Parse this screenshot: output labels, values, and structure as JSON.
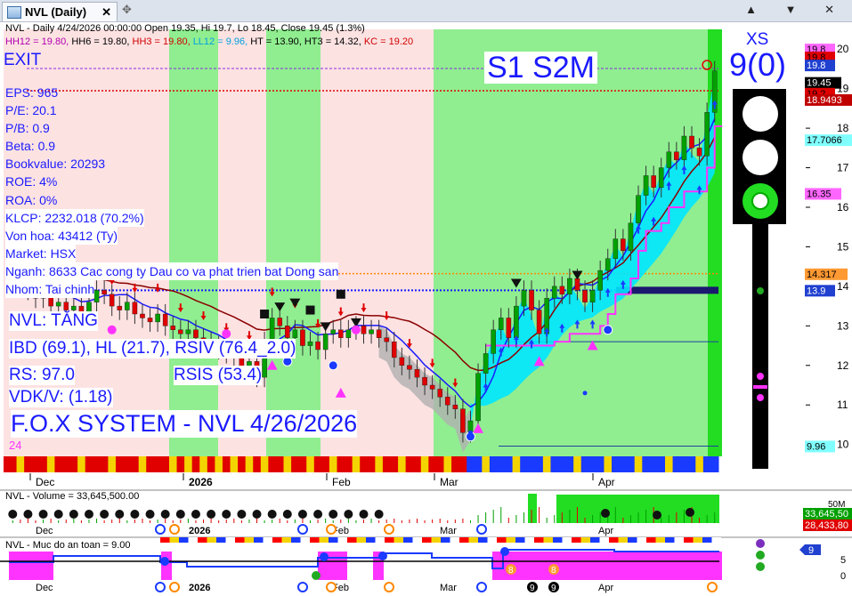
{
  "tab": {
    "title": "NVL (Daily)",
    "close": "✕",
    "pin": "✥",
    "win": [
      "▲",
      "▼",
      "✕"
    ]
  },
  "header": {
    "line1": "NVL - Daily 4/24/2026 00:00:00 Open 19.35, Hi 19.7, Lo 18.45, Close 19.45 (1.3%)",
    "line2": [
      {
        "text": "HH12 = 19.80, ",
        "color": "#b000b0"
      },
      {
        "text": "HH6 = 19.80, ",
        "color": "#000000"
      },
      {
        "text": "HH3 = 19.80, ",
        "color": "#d00000"
      },
      {
        "text": "LL12 = 9.96, ",
        "color": "#00a0e0"
      },
      {
        "text": "HT  = 13.90, ",
        "color": "#000000"
      },
      {
        "text": "HT3  = 14.32, ",
        "color": "#000000"
      },
      {
        "text": "KC = 19.20",
        "color": "#d00000"
      }
    ]
  },
  "overlay": {
    "exit": "EXIT",
    "fundamentals": [
      "EPS: 965",
      "P/E: 20.1",
      "P/B: 0.9",
      "Beta: 0.9",
      "Bookvalue: 20293",
      "ROE: 4%",
      "ROA: 0%",
      "KLCP: 2232.018 (70.2%)",
      "Von hoa: 43412 (Ty)",
      "Market: HSX",
      "Nganh: 8633 Cac cong ty Dau co va phat trien bat Dong san",
      "Nhom: Tai chinh"
    ],
    "status": "NVL: TĂNG",
    "ibd": "IBD (69.1), HL (21.7), RSIV (76.4_2.0)",
    "rs": "RS: 97.0",
    "rsis": "RSIS (53.4)",
    "vdk": "VDK/V:  (1.18)",
    "system": "F.O.X SYSTEM - NVL 4/26/2026",
    "counter": "24",
    "signal": "S1  S2M",
    "xs_label": "XS",
    "xs_value": "9(0)"
  },
  "price_axis": {
    "ticks": [
      "20",
      "19",
      "18",
      "17",
      "16",
      "15",
      "14",
      "13",
      "12",
      "11",
      "10"
    ],
    "badges": [
      {
        "text": "19.8",
        "bg": "#ff66ff",
        "fg": "#000000",
        "y": 19.8,
        "dy": -9
      },
      {
        "text": "19.8",
        "bg": "#e00000",
        "fg": "#000000",
        "y": 19.8,
        "dy": 0
      },
      {
        "text": "19.8",
        "bg": "#2040d0",
        "fg": "#ffffff",
        "y": 19.8,
        "dy": 9
      },
      {
        "text": "19.45",
        "bg": "#000000",
        "fg": "#ffffff",
        "y": 19.45,
        "dy": 13
      },
      {
        "text": "19.2",
        "bg": "#e00000",
        "fg": "#000000",
        "y": 19.2,
        "dy": 14
      },
      {
        "text": "18.9493",
        "bg": "#c00000",
        "fg": "#ffffff",
        "y": 18.9493,
        "dy": 10
      },
      {
        "text": "17.7066",
        "bg": "#80ffff",
        "fg": "#000000",
        "y": 17.7066,
        "dy": 0
      },
      {
        "text": "16.35",
        "bg": "#ff66ff",
        "fg": "#000000",
        "y": 16.35,
        "dy": 0
      },
      {
        "text": "14.317",
        "bg": "#ff9933",
        "fg": "#000000",
        "y": 14.317,
        "dy": 0
      },
      {
        "text": "13.9",
        "bg": "#2040d0",
        "fg": "#ffffff",
        "y": 13.9,
        "dy": 0
      },
      {
        "text": "9.96",
        "bg": "#80ffff",
        "fg": "#000000",
        "y": 9.96,
        "dy": 0
      }
    ]
  },
  "x_axis": {
    "labels": [
      {
        "text": "Dec",
        "bold": false
      },
      {
        "text": "2026",
        "bold": true
      },
      {
        "text": "Feb",
        "bold": false
      },
      {
        "text": "Mar",
        "bold": false
      },
      {
        "text": "Apr",
        "bold": false
      }
    ]
  },
  "volume_panel": {
    "title": "NVL - Volume = 33,645,500.00",
    "tick": "50M",
    "badges": [
      {
        "text": "33,645,50",
        "bg": "#00a000",
        "fg": "#ffffff"
      },
      {
        "text": "28,433,80",
        "bg": "#e00000",
        "fg": "#ffffff"
      }
    ]
  },
  "safety_panel": {
    "title": "NVL - Muc do an toan = 9.00",
    "ticks": [
      "5",
      "0"
    ],
    "badge": {
      "text": "9",
      "bg": "#2040d0",
      "fg": "#ffffff"
    },
    "marks": [
      "8",
      "8",
      "9",
      "9"
    ]
  },
  "colors": {
    "up": "#00a000",
    "down": "#e00000",
    "green_zone": "#90ee90",
    "pink_zone": "#fde2e2",
    "cyan": "#00e5ff",
    "navy": "#1a1a6e"
  },
  "chart_data": {
    "type": "candlestick",
    "title": "NVL (Daily)",
    "ylim": [
      9.7,
      20.5
    ],
    "x_labels": [
      "Dec",
      "2026",
      "Feb",
      "Mar",
      "Apr"
    ],
    "last_bar": {
      "date": "4/24/2026",
      "open": 19.35,
      "high": 19.7,
      "low": 18.45,
      "close": 19.45,
      "change_pct": 1.3
    },
    "levels": {
      "HH12": 19.8,
      "HH6": 19.8,
      "HH3": 19.8,
      "LL12": 9.96,
      "HT": 13.9,
      "HT3": 14.32,
      "KC": 19.2
    },
    "series": [
      {
        "name": "Close",
        "values": [
          14.1,
          14.0,
          13.9,
          13.7,
          13.8,
          13.5,
          13.6,
          13.4,
          13.5,
          13.3,
          13.6,
          13.9,
          13.8,
          13.5,
          13.4,
          13.6,
          13.3,
          13.2,
          13.1,
          13.3,
          13.0,
          12.9,
          12.8,
          12.9,
          12.7,
          12.6,
          12.5,
          12.4,
          12.3,
          12.2,
          11.9,
          12.1,
          11.7,
          12.6,
          13.2,
          13.0,
          12.7,
          12.9,
          12.5,
          12.6,
          12.4,
          12.8,
          12.9,
          12.7,
          12.9,
          13.0,
          12.8,
          12.9,
          12.7,
          12.6,
          12.2,
          12.0,
          11.9,
          11.7,
          11.5,
          11.4,
          11.2,
          11.0,
          10.9,
          10.3,
          10.6,
          11.8,
          12.3,
          12.9,
          13.2,
          12.7,
          13.5,
          13.9,
          13.4,
          12.8,
          13.7,
          14.0,
          13.8,
          14.2,
          13.9,
          13.6,
          13.9,
          14.4,
          14.7,
          15.2,
          14.9,
          15.6,
          16.3,
          16.8,
          16.5,
          17.0,
          17.4,
          17.2,
          17.8,
          17.5,
          17.3,
          18.4,
          19.45
        ]
      }
    ]
  }
}
